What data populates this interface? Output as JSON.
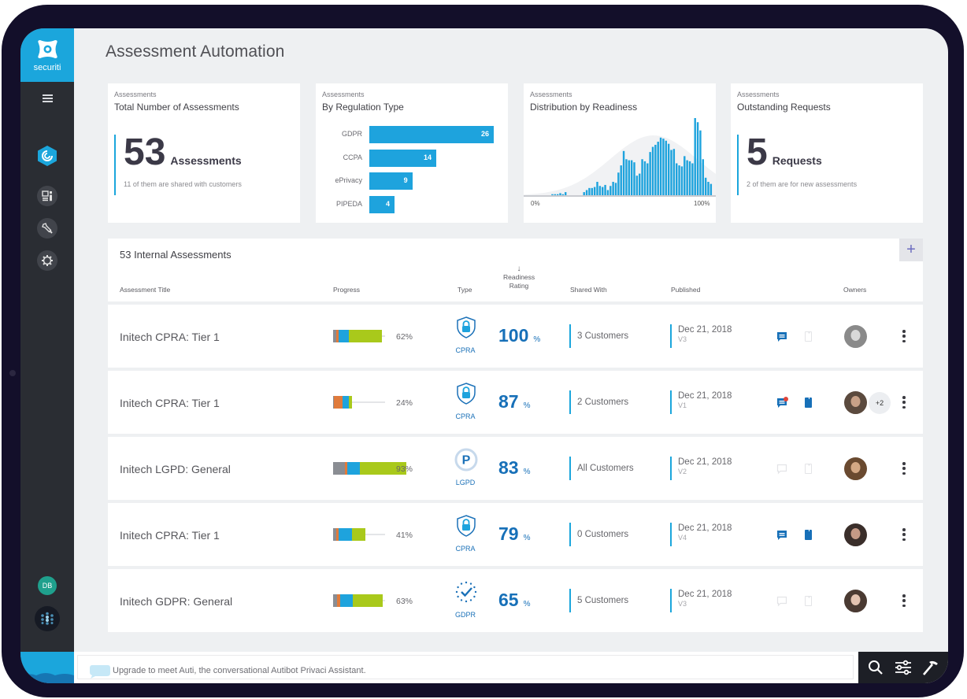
{
  "brand": {
    "name": "securiti",
    "color": "#1ba6dc"
  },
  "sidebar": {
    "menu_icon": "hamburger-icon",
    "items": [
      {
        "id": "privacy",
        "icon": "privacy-hex-icon",
        "active": true
      },
      {
        "id": "dashboard",
        "icon": "dashboard-icon",
        "active": false
      },
      {
        "id": "tools",
        "icon": "wrench-icon",
        "active": false
      },
      {
        "id": "settings",
        "icon": "gear-icon",
        "active": false
      }
    ],
    "user_initials": "DB",
    "apps_icon": "apps-grid-icon"
  },
  "page": {
    "title": "Assessment Automation"
  },
  "cards": {
    "total": {
      "kicker": "Assessments",
      "title": "Total Number of Assessments",
      "value": "53",
      "unit": "Assessments",
      "subtext": "11 of them are shared with customers"
    },
    "regulation": {
      "kicker": "Assessments",
      "title": "By Regulation Type"
    },
    "readiness": {
      "kicker": "Assessments",
      "title": "Distribution by Readiness"
    },
    "requests": {
      "kicker": "Assessments",
      "title": "Outstanding Requests",
      "value": "5",
      "unit": "Requests",
      "subtext": "2 of them are for new assessments"
    }
  },
  "chart_data": [
    {
      "type": "bar",
      "orientation": "horizontal",
      "title": "By Regulation Type",
      "categories": [
        "GDPR",
        "CCPA",
        "ePrivacy",
        "PIPEDA"
      ],
      "values": [
        26,
        14,
        9,
        4
      ],
      "xlim": [
        0,
        26
      ],
      "color": "#1ea3dd",
      "data_labels": true
    },
    {
      "type": "bar",
      "title": "Distribution by Readiness",
      "xlabel_min": "0%",
      "xlabel_max": "100%",
      "color": "#1ea3dd",
      "background_curve": "normal-distribution",
      "values": [
        0,
        0,
        0,
        0,
        0,
        0,
        0,
        0,
        0,
        1,
        1,
        1,
        2,
        1,
        3,
        0,
        0,
        0,
        0,
        0,
        0,
        3,
        5,
        7,
        7,
        8,
        13,
        9,
        8,
        10,
        5,
        9,
        13,
        12,
        22,
        29,
        43,
        35,
        34,
        34,
        32,
        19,
        21,
        35,
        33,
        31,
        42,
        47,
        49,
        52,
        56,
        55,
        53,
        50,
        44,
        45,
        31,
        29,
        28,
        38,
        34,
        33,
        31,
        75,
        71,
        63,
        35,
        17,
        13,
        11
      ]
    }
  ],
  "table": {
    "title": "53 Internal Assessments",
    "add_label": "+",
    "columns": {
      "title": "Assessment Title",
      "progress": "Progress",
      "type": "Type",
      "rating": "Readiness Rating",
      "rating_sort": "↓",
      "shared": "Shared With",
      "published": "Published",
      "owners": "Owners"
    },
    "progress_colors": [
      "#8a8d93",
      "#e07b3c",
      "#1ea3dd",
      "#a9c91b"
    ],
    "rows": [
      {
        "title": "Initech CPRA: Tier 1",
        "progress": 62,
        "segments": [
          4,
          3,
          13,
          42
        ],
        "progress_label": "62%",
        "type": "CPRA",
        "type_icon": "shield-lock-icon",
        "rating": "100",
        "rating_unit": "%",
        "shared": "3 Customers",
        "date": "Dec 21, 2018",
        "version": "V3",
        "comment_active": true,
        "comment_badge": false,
        "doc_active": false,
        "owners_extra": ""
      },
      {
        "title": "Initech CPRA: Tier 1",
        "progress": 24,
        "segments": [
          1,
          11,
          8,
          4
        ],
        "progress_label": "24%",
        "type": "CPRA",
        "type_icon": "shield-lock-icon",
        "rating": "87",
        "rating_unit": "%",
        "shared": "2 Customers",
        "date": "Dec 21, 2018",
        "version": "V1",
        "comment_active": true,
        "comment_badge": true,
        "doc_active": true,
        "owners_extra": "+2"
      },
      {
        "title": "Initech LGPD: General",
        "progress": 93,
        "segments": [
          15,
          3,
          16,
          59
        ],
        "progress_label": "93%",
        "type": "LGPD",
        "type_icon": "p-circle-icon",
        "rating": "83",
        "rating_unit": "%",
        "shared": "All Customers",
        "date": "Dec 21, 2018",
        "version": "V2",
        "comment_active": false,
        "comment_badge": false,
        "doc_active": false,
        "owners_extra": ""
      },
      {
        "title": "Initech CPRA: Tier 1",
        "progress": 41,
        "segments": [
          4,
          3,
          17,
          17
        ],
        "progress_label": "41%",
        "type": "CPRA",
        "type_icon": "shield-lock-icon",
        "rating": "79",
        "rating_unit": "%",
        "shared": "0 Customers",
        "date": "Dec 21, 2018",
        "version": "V4",
        "comment_active": true,
        "comment_badge": false,
        "doc_active": true,
        "owners_extra": ""
      },
      {
        "title": "Initech GDPR: General",
        "progress": 63,
        "segments": [
          5,
          4,
          16,
          38
        ],
        "progress_label": "63%",
        "type": "GDPR",
        "type_icon": "eu-stars-check-icon",
        "rating": "65",
        "rating_unit": "%",
        "shared": "5 Customers",
        "date": "Dec 21, 2018",
        "version": "V3",
        "comment_active": false,
        "comment_badge": false,
        "doc_active": false,
        "owners_extra": ""
      }
    ]
  },
  "assistant": {
    "placeholder": "Upgrade to meet Auti, the conversational Autibot Privaci Assistant."
  },
  "toolbar": {
    "items": [
      "search-icon",
      "sliders-icon",
      "hammer-icon"
    ]
  }
}
